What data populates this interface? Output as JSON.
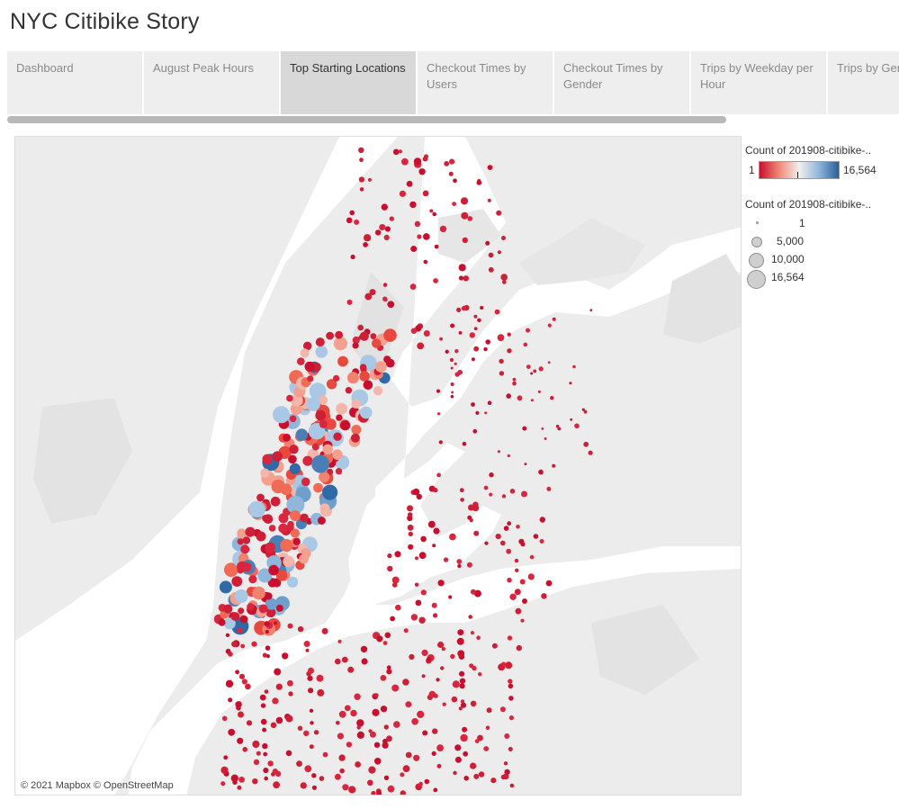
{
  "story": {
    "title": "NYC Citibike Story"
  },
  "tabs": [
    {
      "label": "Dashboard"
    },
    {
      "label": "August Peak Hours"
    },
    {
      "label": "Top Starting Locations",
      "active": true
    },
    {
      "label": "Checkout Times by Users"
    },
    {
      "label": "Checkout Times by Gender"
    },
    {
      "label": "Trips by Weekday per Hour"
    },
    {
      "label": "Trips by Gender(.."
    }
  ],
  "map": {
    "attribution": "© 2021 Mapbox © OpenStreetMap",
    "colors": {
      "land": "#ececec",
      "water": "#ffffff",
      "park": "#e3e3e3",
      "low": "#c8102e",
      "mid": "#f2efee",
      "high": "#2a5d97"
    }
  },
  "legend": {
    "color": {
      "title": "Count of 201908-citibike-..",
      "min": "1",
      "max": "16,564"
    },
    "size": {
      "title": "Count of 201908-citibike-..",
      "items": [
        {
          "label": "1",
          "value": 1
        },
        {
          "label": "5,000",
          "value": 5000
        },
        {
          "label": "10,000",
          "value": 10000
        },
        {
          "label": "16,564",
          "value": 16564
        }
      ]
    }
  }
}
